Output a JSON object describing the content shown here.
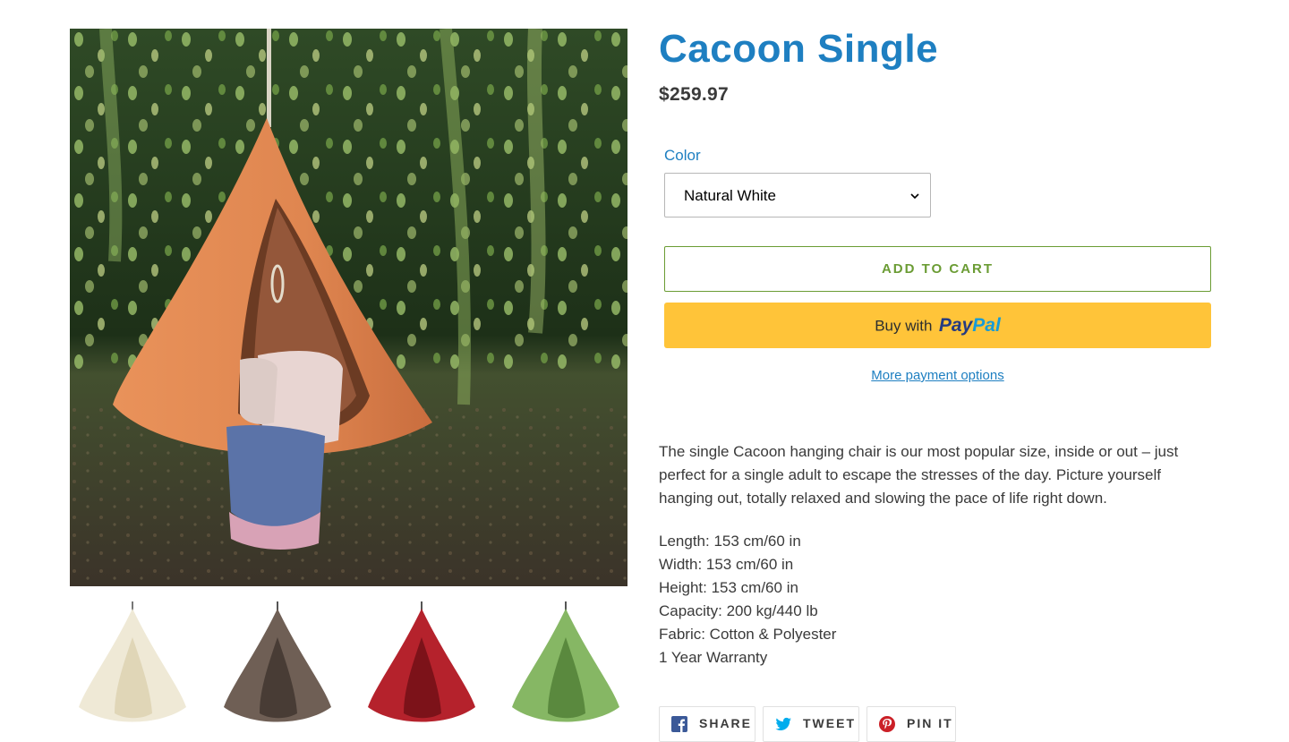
{
  "product": {
    "title": "Cacoon Single",
    "price": "$259.97"
  },
  "variant": {
    "label": "Color",
    "selected": "Natural White"
  },
  "buttons": {
    "add_to_cart": "ADD TO CART",
    "paypal_prefix": "Buy with",
    "paypal_logo_part1": "Pay",
    "paypal_logo_part2": "Pal",
    "more_payment_options": "More payment options"
  },
  "description": "The single Cacoon hanging chair is our most popular size, inside or out – just perfect for a single adult to escape the stresses of the day. Picture yourself hanging out, totally relaxed and slowing the pace of life right down.",
  "specs": [
    "Length: 153 cm/60 in",
    "Width: 153 cm/60 in",
    "Height: 153 cm/60 in",
    "Capacity: 200 kg/440 lb",
    "Fabric: Cotton & Polyester",
    "1 Year Warranty"
  ],
  "share": [
    {
      "label": "SHARE",
      "icon": "facebook-icon"
    },
    {
      "label": "TWEET",
      "icon": "twitter-icon"
    },
    {
      "label": "PIN IT",
      "icon": "pinterest-icon"
    }
  ],
  "thumbnails": [
    {
      "color_name": "Natural White",
      "color": "#efe9d6"
    },
    {
      "color_name": "Brown",
      "color": "#6f5f55"
    },
    {
      "color_name": "Red",
      "color": "#b5222c"
    },
    {
      "color_name": "Green",
      "color": "#86b764"
    }
  ],
  "colors": {
    "title": "#1e7fc1",
    "accent_green": "#6b9c34",
    "paypal_yellow": "#ffc439",
    "hammock_orange": "#df8a55"
  }
}
